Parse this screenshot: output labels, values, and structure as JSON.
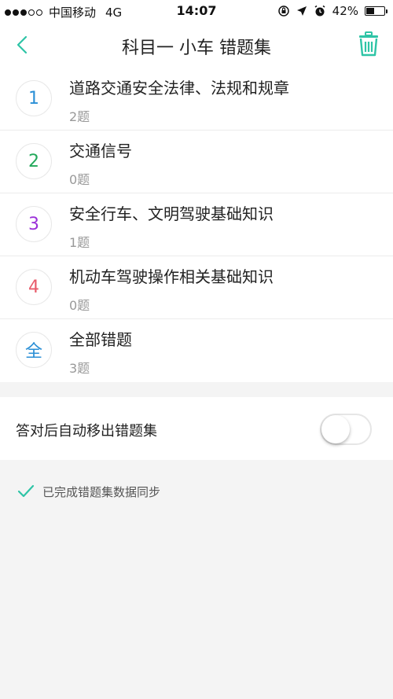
{
  "status_bar": {
    "carrier": "中国移动",
    "network": "4G",
    "time": "14:07",
    "battery_percent": "42%",
    "battery_level": 0.42,
    "signal_bars_filled": 3,
    "signal_bars_total": 5
  },
  "nav": {
    "title": "科目一 小车 错题集",
    "back_icon": "chevron-left-icon",
    "trash_icon": "trash-icon",
    "accent_color": "#2ec4a6"
  },
  "categories": [
    {
      "badge": "1",
      "badge_color": "#2a8fd6",
      "title": "道路交通安全法律、法规和规章",
      "count": "2题"
    },
    {
      "badge": "2",
      "badge_color": "#22a85a",
      "title": "交通信号",
      "count": "0题"
    },
    {
      "badge": "3",
      "badge_color": "#9b30d9",
      "title": "安全行车、文明驾驶基础知识",
      "count": "1题"
    },
    {
      "badge": "4",
      "badge_color": "#e85a6a",
      "title": "机动车驾驶操作相关基础知识",
      "count": "0题"
    },
    {
      "badge": "全",
      "badge_color": "#2a8fd6",
      "title": "全部错题",
      "count": "3题"
    }
  ],
  "auto_remove": {
    "label": "答对后自动移出错题集",
    "enabled": false
  },
  "sync": {
    "text": "已完成错题集数据同步",
    "check_color": "#2ec4a6"
  }
}
